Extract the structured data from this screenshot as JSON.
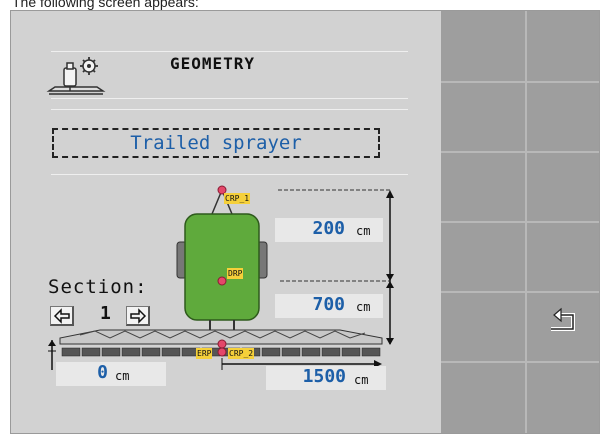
{
  "caption": "The following screen appears:",
  "header": {
    "title": "GEOMETRY"
  },
  "mode": {
    "label": "Trailed sprayer"
  },
  "section": {
    "label": "Section:",
    "value": "1"
  },
  "dimensions": {
    "crp1_to_drp": {
      "value": "200",
      "unit": "cm"
    },
    "drp_to_boom": {
      "value": "700",
      "unit": "cm"
    },
    "lateral_offset": {
      "value": "0",
      "unit": "cm"
    },
    "boom_offset": {
      "value": "1500",
      "unit": "cm"
    }
  },
  "points": {
    "crp1": "CRP_1",
    "drp": "DRP",
    "erp": "ERP",
    "crp2": "CRP_2"
  },
  "softkeys": {
    "back_icon": "back-return-icon"
  },
  "colors": {
    "tank": "#5faa3c",
    "value_text": "#1d5fa8",
    "tag": "#f5d03a",
    "marker": "#e4476a"
  }
}
